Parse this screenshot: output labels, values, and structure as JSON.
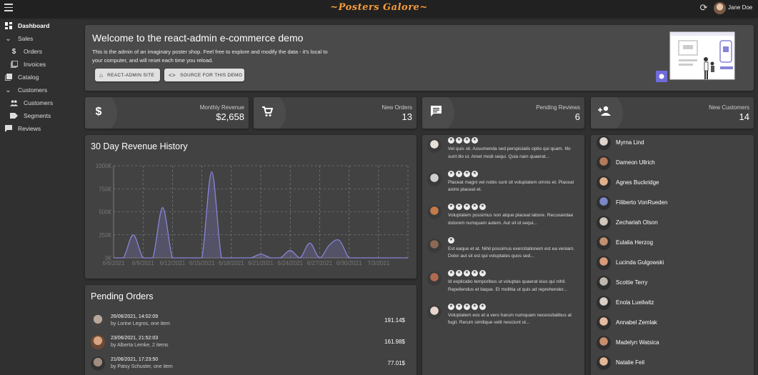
{
  "appbar": {
    "brand": "~Posters Galore~",
    "user_name": "Jane Doe"
  },
  "sidebar": {
    "items": [
      {
        "label": "Dashboard",
        "icon": "dashboard-icon"
      },
      {
        "label": "Sales",
        "icon": "chevron-down-icon"
      },
      {
        "label": "Orders",
        "icon": "dollar-icon"
      },
      {
        "label": "Invoices",
        "icon": "invoices-icon"
      },
      {
        "label": "Catalog",
        "icon": "catalog-icon"
      },
      {
        "label": "Customers",
        "icon": "chevron-down-icon"
      },
      {
        "label": "Customers",
        "icon": "people-icon"
      },
      {
        "label": "Segments",
        "icon": "label-icon"
      },
      {
        "label": "Reviews",
        "icon": "comment-icon"
      }
    ]
  },
  "welcome": {
    "title": "Welcome to the react-admin e-commerce demo",
    "text": "This is the admin of an imaginary poster shop. Feel free to explore and modify the data - it's local to your computer, and will reset each time you reload.",
    "button_site": "REACT-ADMIN SITE",
    "button_source": "SOURCE FOR THIS DEMO"
  },
  "stats": {
    "monthly_revenue": {
      "label": "Monthly Revenue",
      "value": "$2,658"
    },
    "new_orders": {
      "label": "New Orders",
      "value": "13"
    },
    "pending_reviews": {
      "label": "Pending Reviews",
      "value": "6"
    },
    "new_customers": {
      "label": "New Customers",
      "value": "14"
    }
  },
  "revenue_chart": {
    "title": "30 Day Revenue History"
  },
  "chart_data": {
    "type": "area",
    "title": "30 Day Revenue History",
    "y_ticks": [
      "1000€",
      "750€",
      "500€",
      "250€",
      "0€"
    ],
    "ylim": [
      0,
      1000
    ],
    "x_ticks": [
      "6/6/2021",
      "6/9/2021",
      "6/12/2021",
      "6/15/2021",
      "6/18/2021",
      "6/21/2021",
      "6/24/2021",
      "6/27/2021",
      "6/30/2021",
      "7/3/2021"
    ],
    "x_range_days": [
      0,
      30
    ],
    "grid": true,
    "color": "#8884d8",
    "points": [
      [
        0,
        0
      ],
      [
        1,
        0
      ],
      [
        2,
        250
      ],
      [
        3,
        0
      ],
      [
        4,
        0
      ],
      [
        5,
        545
      ],
      [
        6,
        0
      ],
      [
        7,
        0
      ],
      [
        8,
        0
      ],
      [
        9,
        0
      ],
      [
        10,
        935
      ],
      [
        11,
        0
      ],
      [
        12,
        0
      ],
      [
        13,
        0
      ],
      [
        14,
        0
      ],
      [
        15,
        40
      ],
      [
        16,
        0
      ],
      [
        17,
        0
      ],
      [
        18,
        80
      ],
      [
        19,
        0
      ],
      [
        20,
        160
      ],
      [
        21,
        0
      ],
      [
        22,
        140
      ],
      [
        23,
        190
      ],
      [
        24,
        0
      ],
      [
        25,
        0
      ],
      [
        26,
        0
      ],
      [
        27,
        0
      ],
      [
        28,
        0
      ],
      [
        29,
        0
      ],
      [
        30,
        0
      ]
    ]
  },
  "pending_orders": {
    "title": "Pending Orders",
    "items": [
      {
        "date": "26/06/2021, 14:02:09",
        "by": "by Lorine Legros, one item",
        "amount": "191.14$"
      },
      {
        "date": "23/06/2021, 21:52:03",
        "by": "by Alberta Lemke, 2 items",
        "amount": "161.98$"
      },
      {
        "date": "21/06/2021, 17:23:50",
        "by": "by Patsy Schuster, one item",
        "amount": "77.01$"
      }
    ]
  },
  "reviews": [
    {
      "rating": 4,
      "text": "Vel quis sit. Assumenda sed perspiciatis optio qui quam. Illo sunt illo ut. Amet modi sequi. Quia nam quaerat..."
    },
    {
      "rating": 4,
      "text": "Placeat magni vel nobis sunt sit voluptatem omnis et. Placeat animi placeat et."
    },
    {
      "rating": 5,
      "text": "Voluptatem possimus non atque placeat labore. Recusandae dolorem numquam autem. Aut sit id sequi..."
    },
    {
      "rating": 1,
      "text": "Est eaque et at. Nihil possimus exercitationem est ea veniam. Dolor aut sit est qui voluptates quos sed..."
    },
    {
      "rating": 5,
      "text": "Id explicabo temporibus ut voluptas quaerat eius qui nihil. Repellendus et itaque. Et mollitia ut quis ad reprehender..."
    },
    {
      "rating": 5,
      "text": "Voluptatem eos et a vero harum numquam necessitatibus at fugit. Rerum similique velit nesciunt ut..."
    }
  ],
  "customers": [
    "Myrna Lind",
    "Dameon Ullrich",
    "Agnes Buckridge",
    "Filiberto VonRueden",
    "Zechariah Olson",
    "Eulalia Herzog",
    "Lucinda Gulgowski",
    "Scottie Terry",
    "Enola Lueilwitz",
    "Annabel Zemlak",
    "Madelyn Watsica",
    "Natalie Feil"
  ],
  "colors": {
    "accent": "#8884d8",
    "brand": "#f59c3d",
    "background": "#303030",
    "card": "#424242"
  }
}
